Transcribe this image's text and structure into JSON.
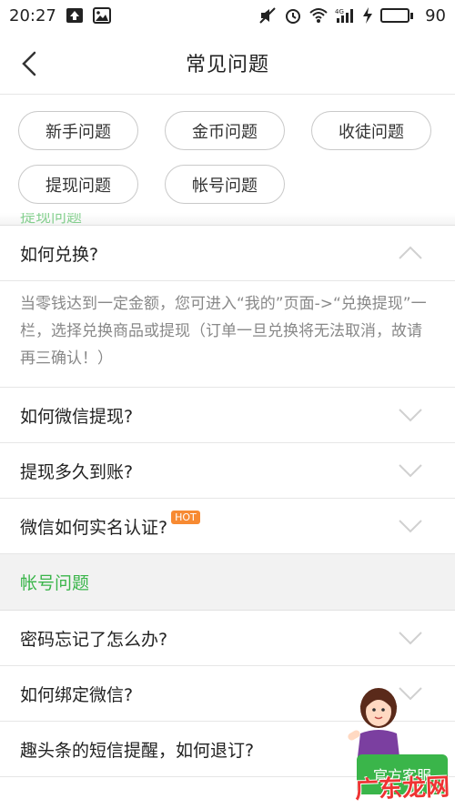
{
  "status_bar": {
    "time": "20:27",
    "battery_level": "90",
    "network": "4G"
  },
  "header": {
    "title": "常见问题"
  },
  "categories": [
    "新手问题",
    "金币问题",
    "收徒问题",
    "提现问题",
    "帐号问题"
  ],
  "faq_sections": [
    {
      "partial_title": "提现问题",
      "items": [
        {
          "question": "如何兑换?",
          "expanded": true,
          "answer": "当零钱达到一定金额，您可进入“我的”页面->“兑换提现”一栏，选择兑换商品或提现（订单一旦兑换将无法取消，故请再三确认！）"
        },
        {
          "question": "如何微信提现?",
          "expanded": false
        },
        {
          "question": "提现多久到账?",
          "expanded": false
        },
        {
          "question": "微信如何实名认证?",
          "expanded": false,
          "badge": "HOT"
        }
      ]
    },
    {
      "title": "帐号问题",
      "items": [
        {
          "question": "密码忘记了怎么办?"
        },
        {
          "question": "如何绑定微信?"
        },
        {
          "question": "趣头条的短信提醒，如何退订?"
        }
      ]
    }
  ],
  "support": {
    "label": "官方客服",
    "watermark": "广东龙网"
  },
  "colors": {
    "accent": "#3ab54a",
    "hot": "#f78a32"
  }
}
